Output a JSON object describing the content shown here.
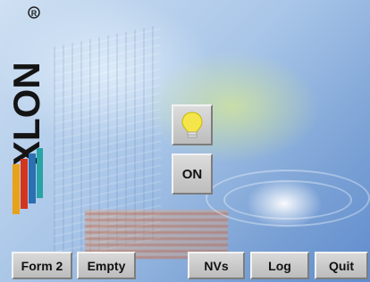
{
  "controls": {
    "light_state_label": "ON"
  },
  "toolbar": {
    "form2_label": "Form 2",
    "empty_label": "Empty",
    "nvs_label": "NVs",
    "log_label": "Log",
    "quit_label": "Quit"
  },
  "icons": {
    "lamp": "lightbulb-icon",
    "brand": "exlon-logo"
  },
  "colors": {
    "bulb": "#f4e64a",
    "button_face": "#c8c8c8"
  }
}
